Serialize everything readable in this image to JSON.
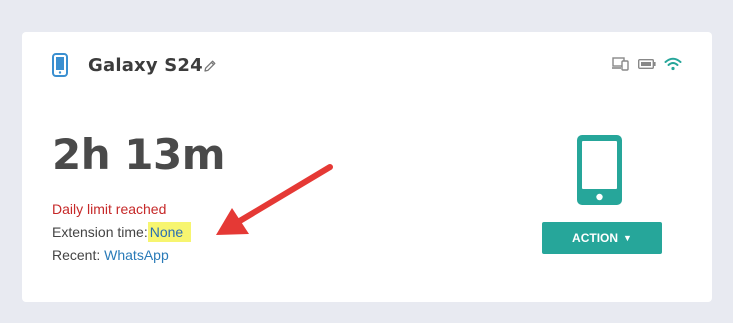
{
  "device": {
    "name": "Galaxy S24",
    "time_used": "2h 13m",
    "limit_message": "Daily limit reached",
    "extension_label": "Extension time:",
    "extension_value": "None",
    "recent_label": "Recent:",
    "recent_app": "WhatsApp"
  },
  "action_button": {
    "label": "ACTION",
    "caret": "▼"
  },
  "colors": {
    "accent": "#26a69a",
    "device_icon": "#3a8fd0",
    "limit_red": "#c62828",
    "highlight": "#f7f570",
    "arrow": "#e53935"
  },
  "icons": [
    "phone-icon",
    "edit-pencil-icon",
    "devices-icon",
    "battery-icon",
    "wifi-icon",
    "large-phone-icon"
  ]
}
